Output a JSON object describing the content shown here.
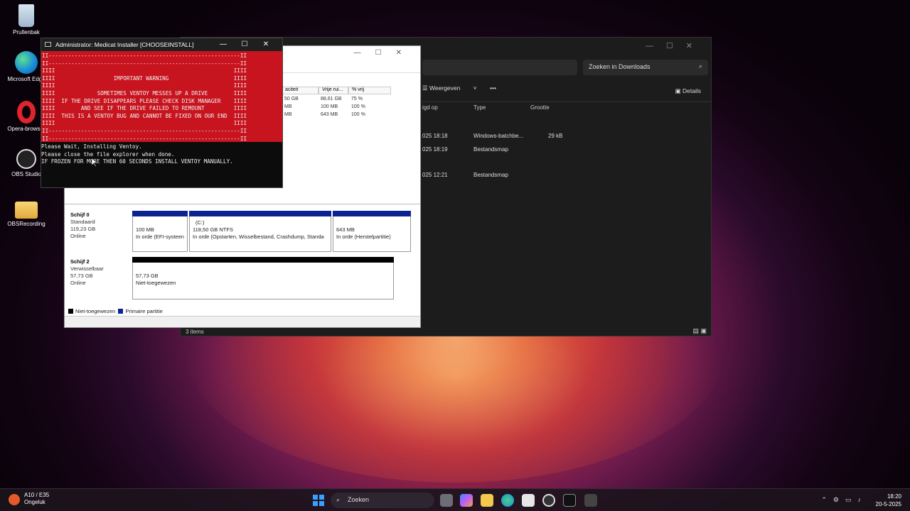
{
  "desktop": {
    "icons": [
      {
        "label": "Prullenbak",
        "icon": "recycle-bin-icon"
      },
      {
        "label": "Microsoft Edge",
        "icon": "edge-icon"
      },
      {
        "label": "Opera-browser",
        "icon": "opera-icon"
      },
      {
        "label": "OBS Studio",
        "icon": "obs-icon"
      },
      {
        "label": "OBSRecording",
        "icon": "folder-icon"
      }
    ]
  },
  "explorer": {
    "search_placeholder": "Zoeken in Downloads",
    "view_label": "Weergeven",
    "more_label": "•••",
    "details_label": "Details",
    "columns": [
      "igd op",
      "Type",
      "Grootte"
    ],
    "rows": [
      {
        "date": "025 18:18",
        "type": "Windows-batchbe...",
        "size": "29 kB"
      },
      {
        "date": "025 18:19",
        "type": "Bestandsmap",
        "size": ""
      },
      {
        "date": "025 12:21",
        "type": "Bestandsmap",
        "size": ""
      }
    ],
    "status": "3 items"
  },
  "disk_management": {
    "volume_columns": [
      "aciteit",
      "Vrije rui...",
      "% vrij"
    ],
    "volume_rows": [
      [
        "50 GB",
        "88,61 GB",
        "75 %"
      ],
      [
        "MB",
        "100 MB",
        "100 %"
      ],
      [
        "MB",
        "643 MB",
        "100 %"
      ]
    ],
    "disks": [
      {
        "name": "Schijf 0",
        "type": "Standaard",
        "size": "119,23 GB",
        "state": "Online",
        "partitions": [
          {
            "line1": "100 MB",
            "line2": "In orde (EFI-systeen"
          },
          {
            "line0": "(C:)",
            "line1": "118,50 GB NTFS",
            "line2": "In orde (Opstarten, Wisselbestand, Crashdump, Standa"
          },
          {
            "line1": "643 MB",
            "line2": "In orde (Herstelpartitie)"
          }
        ]
      },
      {
        "name": "Schijf 2",
        "type": "Verwisselbaar",
        "size": "57,73 GB",
        "state": "Online",
        "partitions": [
          {
            "line1": "57,73 GB",
            "line2": "Niet-toegewezen"
          }
        ]
      }
    ],
    "legend": [
      "Niet-toegewezen",
      "Primaire partitie"
    ]
  },
  "console": {
    "title": "Administrator:  Medicat Installer [CHOOSEINSTALL]",
    "warning_text": "II-----------------------------------------------------------II\nII-----------------------------------------------------------II\nIIII                                                       IIII\nIIII                  IMPORTANT WARNING                    IIII\nIIII                                                       IIII\nIIII             SOMETIMES VENTOY MESSES UP A DRIVE        IIII\nIIII  IF THE DRIVE DISAPPEARS PLEASE CHECK DISK MANAGER    IIII\nIIII        AND SEE IF THE DRIVE FAILED TO REMOUNT         IIII\nIIII  THIS IS A VENTOY BUG AND CANNOT BE FIXED ON OUR END  IIII\nIIII                                                       IIII\nII-----------------------------------------------------------II\nII-----------------------------------------------------------II",
    "output_text": "Please Wait, Installing Ventoy.\nPlease close the file explorer when done.\nIF FROZEN FOR MORE THEN 60 SECONDS INSTALL VENTOY MANUALLY."
  },
  "taskbar": {
    "weather_line1": "A10 / E35",
    "weather_line2": "Ongeluk",
    "search_label": "Zoeken",
    "time": "18:20",
    "date": "20-5-2025"
  }
}
